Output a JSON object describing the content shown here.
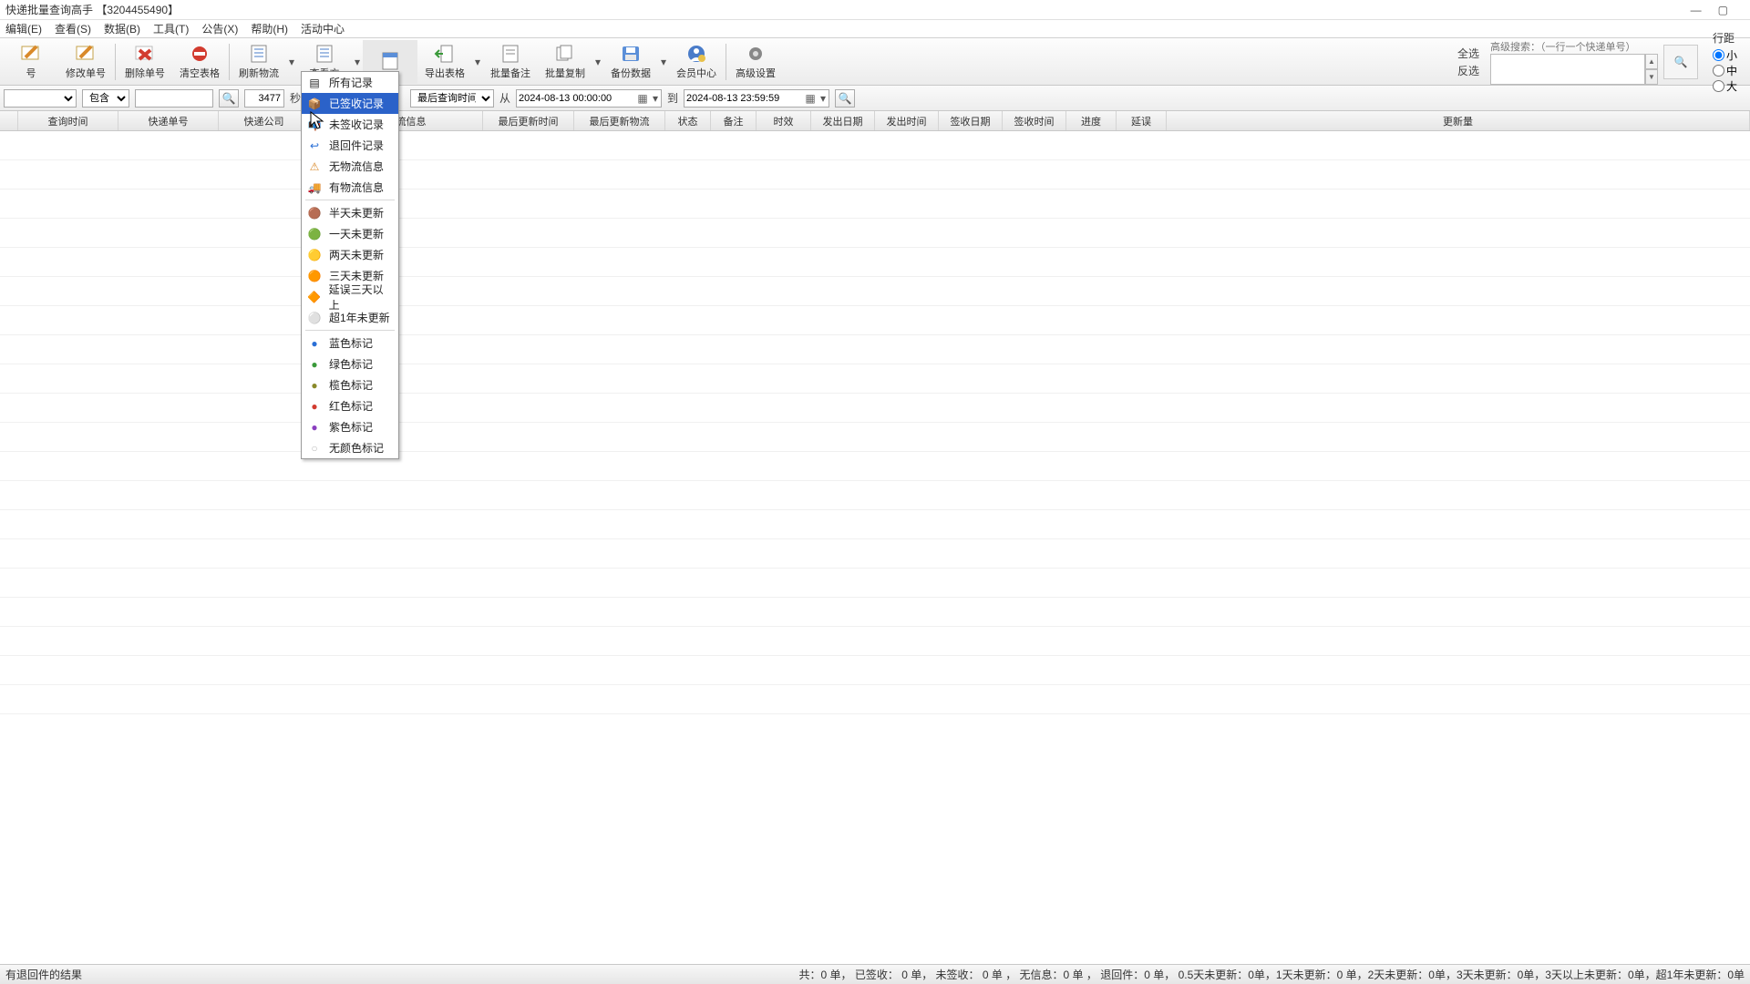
{
  "window": {
    "title": "快递批量查询高手 【3204455490】"
  },
  "menus": {
    "edit": "编辑(E)",
    "view": "查看(S)",
    "data": "数据(B)",
    "tools": "工具(T)",
    "notice": "公告(X)",
    "help": "帮助(H)",
    "activity": "活动中心"
  },
  "toolbar": {
    "add": "号",
    "modify": "修改单号",
    "delete": "删除单号",
    "clear": "清空表格",
    "refresh": "刷新物流",
    "view": "查看方",
    "export": "导出表格",
    "batch_remark": "批量备注",
    "batch_copy": "批量复制",
    "backup": "备份数据",
    "member": "会员中心",
    "advanced": "高级设置"
  },
  "select_labels": {
    "all": "全选",
    "invert": "反选"
  },
  "adv_search": {
    "hint": "高级搜索：（一行一个快递单号）"
  },
  "rowheight": {
    "header": "行距",
    "small": "小",
    "medium": "中",
    "large": "大"
  },
  "filter": {
    "match_mode": "包含",
    "number": "3477",
    "sec_label": "秒后",
    "time_field": "最后查询时间",
    "from_label": "从",
    "from_value": "2024-08-13 00:00:00",
    "to_label": "到",
    "to_value": "2024-08-13 23:59:59"
  },
  "columns": {
    "c0": "",
    "c1": "查询时间",
    "c2": "快递单号",
    "c3": "快递公司",
    "c4": "发出物流信息",
    "c5": "最后更新时间",
    "c6": "最后更新物流",
    "c7": "状态",
    "c8": "备注",
    "c9": "时效",
    "c10": "发出日期",
    "c11": "发出时间",
    "c12": "签收日期",
    "c13": "签收时间",
    "c14": "进度",
    "c15": "延误",
    "c16": "更新量"
  },
  "dropdown": {
    "all": "所有记录",
    "signed": "已签收记录",
    "unsigned": "未签收记录",
    "returned": "退回件记录",
    "no_logi": "无物流信息",
    "has_logi": "有物流信息",
    "half_day": "半天未更新",
    "one_day": "一天未更新",
    "two_day": "两天未更新",
    "three_day": "三天未更新",
    "delay3": "延误三天以上",
    "year1": "超1年未更新",
    "blue": "蓝色标记",
    "green": "绿色标记",
    "olive": "榄色标记",
    "red": "红色标记",
    "purple": "紫色标记",
    "none": "无颜色标记"
  },
  "status": {
    "left": "有退回件的结果",
    "right": "共：0 单，  已签收：  0 单， 未签收：  0 单 ， 无信息：0 单 ， 退回件：0 单，  0.5天未更新：0单，1天未更新：0 单，2天未更新：0单，3天未更新：0单，3天以上未更新：0单，超1年未更新：0单"
  },
  "colors": {
    "accent": "#2b62c9",
    "red": "#d23b2f",
    "green": "#3a9a3a",
    "orange": "#d98a2b",
    "blue": "#2a6fd6"
  }
}
